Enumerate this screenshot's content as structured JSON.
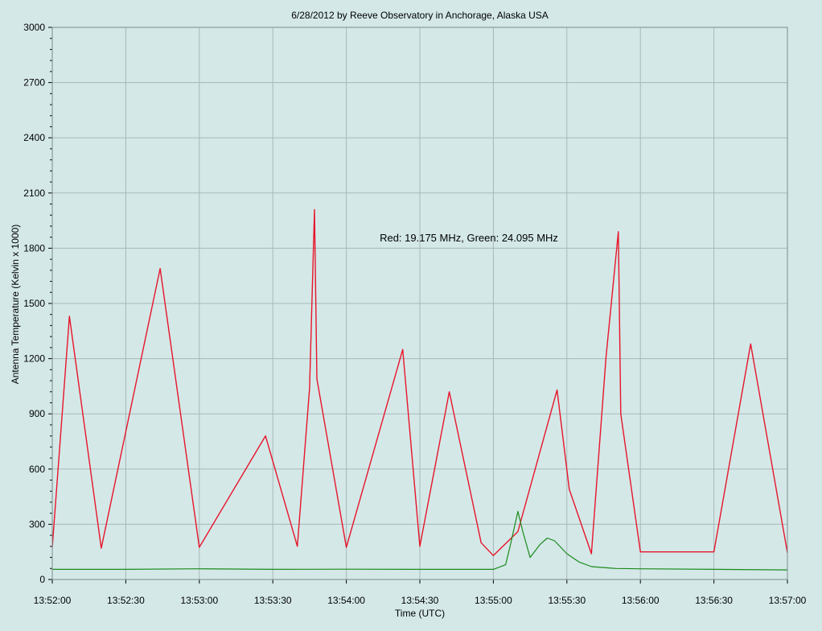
{
  "chart_data": {
    "type": "line",
    "title": "6/28/2012  by  Reeve Observatory  in  Anchorage, Alaska  USA",
    "annotation": "Red: 19.175 MHz, Green: 24.095 MHz",
    "xlabel": "Time (UTC)",
    "ylabel": "Antenna Temperature (Kelvin x 1000)",
    "ylim": [
      0,
      3000
    ],
    "y_ticks": [
      0,
      300,
      600,
      900,
      1200,
      1500,
      1800,
      2100,
      2400,
      2700,
      3000
    ],
    "xlim": [
      "13:52:00",
      "13:57:00"
    ],
    "x_ticks": [
      "13:52:00",
      "13:52:30",
      "13:53:00",
      "13:53:30",
      "13:54:00",
      "13:54:30",
      "13:55:00",
      "13:55:30",
      "13:56:00",
      "13:56:30",
      "13:57:00"
    ],
    "grid": true,
    "series": [
      {
        "name": "19.175 MHz",
        "color": "#e8142a",
        "points": [
          [
            "13:52:00",
            175
          ],
          [
            "13:52:07",
            1430
          ],
          [
            "13:52:20",
            170
          ],
          [
            "13:52:44",
            1690
          ],
          [
            "13:53:00",
            175
          ],
          [
            "13:53:27",
            780
          ],
          [
            "13:53:40",
            180
          ],
          [
            "13:53:45",
            1040
          ],
          [
            "13:53:47",
            2010
          ],
          [
            "13:53:48",
            1090
          ],
          [
            "13:54:00",
            175
          ],
          [
            "13:54:23",
            1250
          ],
          [
            "13:54:30",
            180
          ],
          [
            "13:54:42",
            1020
          ],
          [
            "13:54:55",
            200
          ],
          [
            "13:55:00",
            130
          ],
          [
            "13:55:10",
            260
          ],
          [
            "13:55:26",
            1030
          ],
          [
            "13:55:31",
            490
          ],
          [
            "13:55:40",
            140
          ],
          [
            "13:55:46",
            1210
          ],
          [
            "13:55:51",
            1890
          ],
          [
            "13:55:52",
            900
          ],
          [
            "13:56:00",
            150
          ],
          [
            "13:56:30",
            150
          ],
          [
            "13:56:45",
            1280
          ],
          [
            "13:57:00",
            145
          ]
        ]
      },
      {
        "name": "24.095 MHz",
        "color": "#1a8a1a",
        "points": [
          [
            "13:52:00",
            55
          ],
          [
            "13:52:30",
            55
          ],
          [
            "13:53:00",
            58
          ],
          [
            "13:53:30",
            55
          ],
          [
            "13:54:00",
            56
          ],
          [
            "13:54:30",
            55
          ],
          [
            "13:55:00",
            55
          ],
          [
            "13:55:05",
            80
          ],
          [
            "13:55:07",
            190
          ],
          [
            "13:55:10",
            370
          ],
          [
            "13:55:12",
            260
          ],
          [
            "13:55:15",
            120
          ],
          [
            "13:55:19",
            190
          ],
          [
            "13:55:22",
            225
          ],
          [
            "13:55:25",
            210
          ],
          [
            "13:55:30",
            140
          ],
          [
            "13:55:35",
            95
          ],
          [
            "13:55:40",
            70
          ],
          [
            "13:55:50",
            60
          ],
          [
            "13:56:00",
            58
          ],
          [
            "13:56:30",
            55
          ],
          [
            "13:57:00",
            52
          ]
        ]
      }
    ]
  }
}
